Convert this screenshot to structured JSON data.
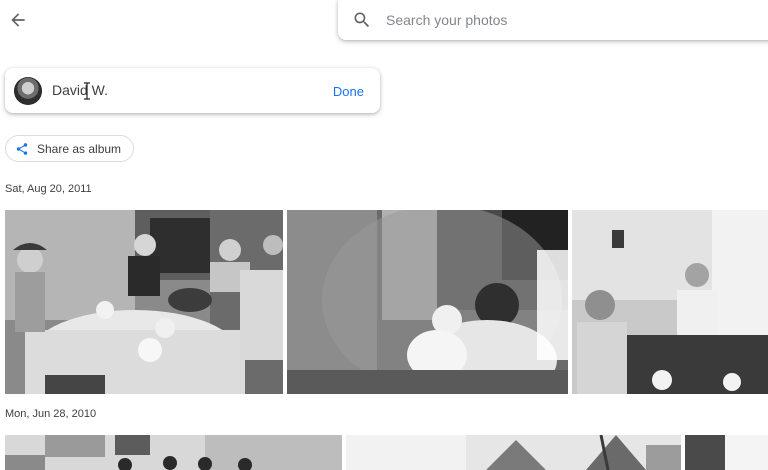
{
  "header": {
    "back_icon": "arrow-back-icon",
    "search": {
      "icon": "search-icon",
      "placeholder": "Search your photos",
      "value": ""
    }
  },
  "person_card": {
    "name": "David W.",
    "done_label": "Done"
  },
  "share": {
    "icon": "share-icon",
    "label": "Share as album",
    "icon_color": "#1a73e8"
  },
  "groups": [
    {
      "date": "Sat, Aug 20, 2011",
      "photos": [
        {
          "desc": "Boys in cowboy outfits at a dining table"
        },
        {
          "desc": "Man holding a baby"
        },
        {
          "desc": "Two men seated at a table"
        }
      ]
    },
    {
      "date": "Mon, Jun 28, 2010",
      "photos": [
        {
          "desc": "Group standing in front of a house"
        },
        {
          "desc": "Outdoor scene with trees"
        },
        {
          "desc": "Partial photo"
        }
      ]
    }
  ],
  "colors": {
    "accent": "#1a73e8",
    "text": "#202124",
    "secondary_text": "#5f6368"
  }
}
